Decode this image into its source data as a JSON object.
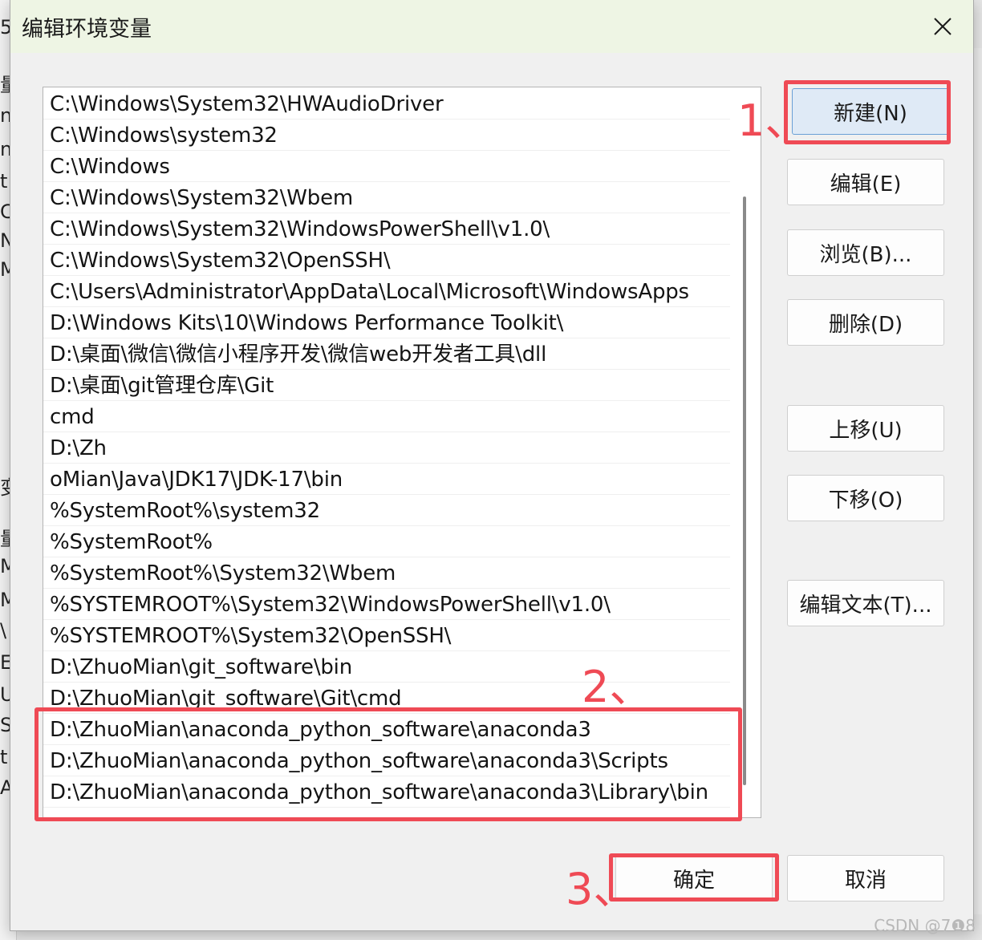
{
  "dialog": {
    "title": "编辑环境变量"
  },
  "paths": [
    "C:\\Windows\\System32\\HWAudioDriver",
    "C:\\Windows\\system32",
    "C:\\Windows",
    "C:\\Windows\\System32\\Wbem",
    "C:\\Windows\\System32\\WindowsPowerShell\\v1.0\\",
    "C:\\Windows\\System32\\OpenSSH\\",
    "C:\\Users\\Administrator\\AppData\\Local\\Microsoft\\WindowsApps",
    "D:\\Windows Kits\\10\\Windows Performance Toolkit\\",
    "D:\\桌面\\微信\\微信小程序开发\\微信web开发者工具\\dll",
    "D:\\桌面\\git管理仓库\\Git",
    "cmd",
    "D:\\Zh",
    "oMian\\Java\\JDK17\\JDK-17\\bin",
    "%SystemRoot%\\system32",
    "%SystemRoot%",
    "%SystemRoot%\\System32\\Wbem",
    "%SYSTEMROOT%\\System32\\WindowsPowerShell\\v1.0\\",
    "%SYSTEMROOT%\\System32\\OpenSSH\\",
    "D:\\ZhuoMian\\git_software\\bin",
    "D:\\ZhuoMian\\git_software\\Git\\cmd",
    "D:\\ZhuoMian\\anaconda_python_software\\anaconda3",
    "D:\\ZhuoMian\\anaconda_python_software\\anaconda3\\Scripts",
    "D:\\ZhuoMian\\anaconda_python_software\\anaconda3\\Library\\bin"
  ],
  "buttons": {
    "new": "新建(N)",
    "edit": "编辑(E)",
    "browse": "浏览(B)...",
    "delete": "删除(D)",
    "move_up": "上移(U)",
    "move_down": "下移(O)",
    "edit_text": "编辑文本(T)...",
    "ok": "确定",
    "cancel": "取消"
  },
  "annotations": {
    "step1": "1、",
    "step2": "2、",
    "step3": "3、"
  },
  "background_glyphs": [
    "5",
    "量",
    "n",
    "n",
    "t",
    "C",
    "N",
    "M",
    "变",
    "量",
    "M",
    "M",
    "\\",
    "E",
    "U",
    "S",
    "t",
    "A"
  ],
  "watermark": "CSDN @7❶8",
  "colors": {
    "annotation_red": "#ef4a55",
    "primary_button": "#dfeaf6",
    "titlebar": "#eef5e4"
  }
}
